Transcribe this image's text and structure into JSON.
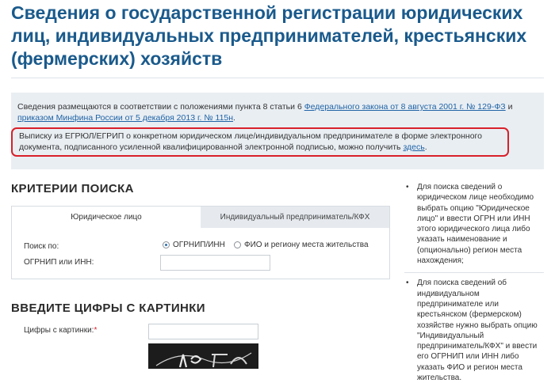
{
  "page": {
    "title": "Сведения о государственной регистрации юридических лиц, индивидуальных предпринимателей, крестьянских (фермерских) хозяйств"
  },
  "info": {
    "text_before": "Сведения размещаются в соответствии с положениями пункта 8 статьи 6 ",
    "law_link": "Федерального закона от 8 августа 2001 г. № 129-ФЗ",
    "text_middle": " и ",
    "order_link": "приказом Минфина России от 5 декабря 2013 г. № 115н",
    "text_end": ".",
    "extract_text": "Выписку из ЕГРЮЛ/ЕГРИП о конкретном юридическом лице/индивидуальном предпринимателе в форме электронного документа, подписанного усиленной квалифицированной электронной подписью, можно получить ",
    "extract_link": "здесь",
    "extract_end": "."
  },
  "search": {
    "section_title": "КРИТЕРИИ ПОИСКА",
    "tabs": [
      {
        "label": "Юридическое лицо",
        "active": true
      },
      {
        "label": "Индивидуальный предприниматель/КФХ",
        "active": false
      }
    ],
    "search_by_label": "Поиск по:",
    "options": [
      {
        "label": "ОГРНИП/ИНН",
        "checked": true
      },
      {
        "label": "ФИО и региону места жительства",
        "checked": false
      }
    ],
    "ogrnip_label": "ОГРНИП или ИНН:",
    "ogrnip_value": ""
  },
  "captcha": {
    "section_title": "ВВЕДИТЕ ЦИФРЫ С КАРТИНКИ",
    "label": "Цифры с картинки:",
    "required_mark": "*",
    "value": ""
  },
  "sidebar": {
    "items": [
      "Для поиска сведений о юридическом лице необходимо выбрать опцию \"Юридическое лицо\" и ввести ОГРН или ИНН этого юридического лица либо указать наименование и (опционально) регион места нахождения;",
      "Для поиска сведений об индивидуальном предпринимателе или крестьянском (фермерском) хозяйстве нужно выбрать опцию \"Индивидуальный предприниматель/КФХ\" и ввести его ОГРНИП или ИНН либо указать ФИО и регион места жительства."
    ]
  },
  "colors": {
    "title": "#1a5a8c",
    "link": "#2064a6",
    "highlight_border": "#d8202a",
    "info_bg": "#e9eef3"
  }
}
